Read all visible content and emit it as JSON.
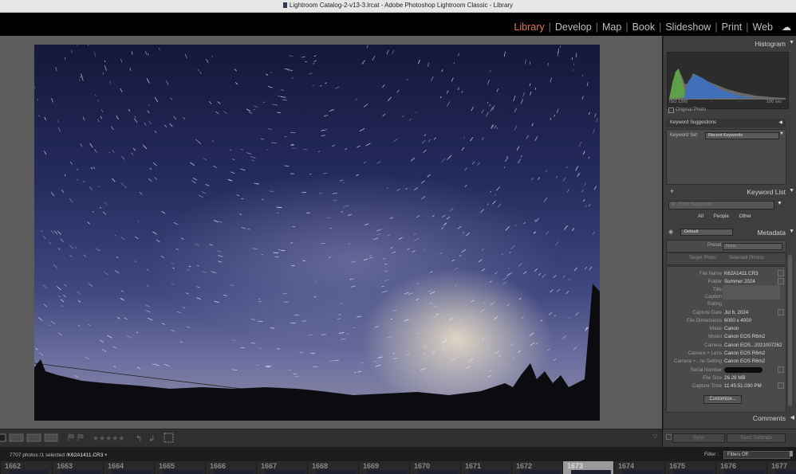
{
  "window": {
    "title": "Lightroom Catalog-2-v13-3.lrcat - Adobe Photoshop Lightroom Classic - Library"
  },
  "modules": {
    "items": [
      "Library",
      "Develop",
      "Map",
      "Book",
      "Slideshow",
      "Print",
      "Web"
    ],
    "active": "Library",
    "cloud": "cloud-icon"
  },
  "histogram": {
    "header": "Histogram",
    "iso": "ISO 1200",
    "dash1": "-",
    "dash2": "-",
    "shutter": "100 sec",
    "original_photo": "Original Photo"
  },
  "keyword_suggestions": {
    "header": "Keyword Suggestions"
  },
  "keyword_set": {
    "label": "Keyword Set",
    "value": "Recent Keywords"
  },
  "keyword_list": {
    "header": "Keyword List",
    "plus": "+",
    "filter_placeholder": "Filter Keywords",
    "tabs": [
      "All",
      "People",
      "Other"
    ]
  },
  "metadata": {
    "header": "Metadata",
    "preset_dropdown": "Default",
    "preset_label": "Preset",
    "preset_value": "None",
    "target_photo": "Target Photo",
    "selected_photos": "Selected Photos",
    "rows": [
      {
        "k": "File Name",
        "v": "K62A1411.CR3"
      },
      {
        "k": "Folder",
        "v": "Summer 2024"
      },
      {
        "k": "Title",
        "v": ""
      },
      {
        "k": "Caption",
        "v": ""
      },
      {
        "k": "Rating",
        "v": ""
      },
      {
        "k": "Capture Date",
        "v": "Jul 6, 2024"
      },
      {
        "k": "File Dimensions",
        "v": "6000 x 4000"
      },
      {
        "k": "Make",
        "v": "Canon"
      },
      {
        "k": "Model",
        "v": "Canon EOS R6m2"
      },
      {
        "k": "Camera",
        "v": "Canon EOS...2021007262"
      },
      {
        "k": "Camera + Lens",
        "v": "Canon EOS R6m2"
      },
      {
        "k": "Camera +...ns Setting",
        "v": "Canon EOS R6m2"
      },
      {
        "k": "Serial Number",
        "v": ""
      },
      {
        "k": "File Size",
        "v": "26.29 MB"
      },
      {
        "k": "Capture Time",
        "v": "11:45:51.030 PM"
      }
    ],
    "customize": "Customize..."
  },
  "comments": {
    "header": "Comments"
  },
  "sync": {
    "sync": "Sync",
    "sync_settings": "Sync Settings"
  },
  "status": {
    "count": "7707 photos /1 selected /",
    "file": "K62A1411.CR3",
    "filter_label": "Filter :",
    "filter_value": "Filters Off"
  },
  "filmstrip": {
    "numbers": [
      "1662",
      "1663",
      "1664",
      "1665",
      "1666",
      "1667",
      "1668",
      "1669",
      "1670",
      "1671",
      "1672",
      "1673",
      "1674",
      "1675",
      "1676",
      "1677"
    ],
    "selected": "1673"
  }
}
